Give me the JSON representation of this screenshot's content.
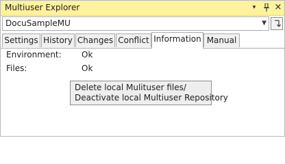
{
  "window": {
    "title": "Multiuser Explorer",
    "dropdown_icon": "▾",
    "pin_icon": "ᵻ",
    "close_icon": "×"
  },
  "project_selector": {
    "value": "DocuSampleMU"
  },
  "tabs": [
    {
      "label": "Settings"
    },
    {
      "label": "History"
    },
    {
      "label": "Changes"
    },
    {
      "label": "Conflict"
    },
    {
      "label": "Information"
    },
    {
      "label": "Manual"
    }
  ],
  "active_tab": "Information",
  "info": {
    "environment_label": "Environment:",
    "environment_value": "Ok",
    "files_label": "Files:",
    "files_value": "Ok"
  },
  "context_menu": {
    "item_line1": "Delete local Mulituser files/",
    "item_line2": "Deactivate local Multiuser Repository"
  }
}
